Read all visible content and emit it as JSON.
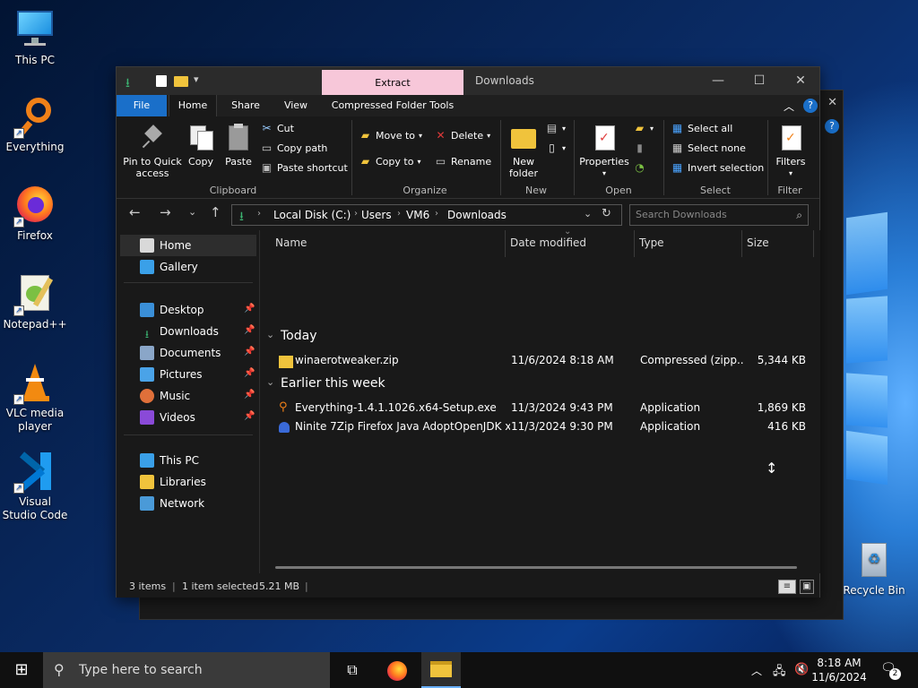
{
  "desktop": {
    "icons": [
      {
        "label": "This PC",
        "icon": "monitor-icon"
      },
      {
        "label": "Everything",
        "icon": "everything-magnifier-icon"
      },
      {
        "label": "Firefox",
        "icon": "firefox-icon"
      },
      {
        "label": "Notepad++",
        "icon": "notepad-plus-plus-icon"
      },
      {
        "label": "VLC media player",
        "icon": "vlc-cone-icon"
      },
      {
        "label": "Visual Studio Code",
        "icon": "vscode-icon"
      },
      {
        "label": "Recycle Bin",
        "icon": "recycle-bin-icon"
      }
    ]
  },
  "window": {
    "context_tab": "Extract",
    "title": "Downloads",
    "ribbon_tabs": [
      "File",
      "Home",
      "Share",
      "View",
      "Compressed Folder Tools"
    ],
    "ribbon": {
      "clipboard": {
        "pin_label": "Pin to Quick access",
        "copy": "Copy",
        "paste": "Paste",
        "cut": "Cut",
        "copy_path": "Copy path",
        "paste_shortcut": "Paste shortcut",
        "group": "Clipboard"
      },
      "organize": {
        "move_to": "Move to",
        "copy_to": "Copy to",
        "delete": "Delete",
        "rename": "Rename",
        "group": "Organize"
      },
      "new": {
        "new_folder": "New folder",
        "group": "New"
      },
      "open": {
        "properties": "Properties",
        "group": "Open"
      },
      "select": {
        "select_all": "Select all",
        "select_none": "Select none",
        "invert": "Invert selection",
        "group": "Select"
      },
      "filter": {
        "filters": "Filters",
        "group": "Filter"
      }
    },
    "address": {
      "crumbs": [
        "Local Disk (C:)",
        "Users",
        "VM6",
        "Downloads"
      ],
      "search_placeholder": "Search Downloads"
    },
    "nav": {
      "home": "Home",
      "gallery": "Gallery",
      "quick": [
        "Desktop",
        "Downloads",
        "Documents",
        "Pictures",
        "Music",
        "Videos"
      ],
      "this_pc": "This PC",
      "libraries": "Libraries",
      "network": "Network"
    },
    "columns": {
      "name": "Name",
      "date": "Date modified",
      "type": "Type",
      "size": "Size"
    },
    "groups": [
      {
        "title": "Today",
        "files": [
          {
            "name": "winaerotweaker.zip",
            "date": "11/6/2024 8:18 AM",
            "type": "Compressed (zipp...",
            "size": "5,344 KB"
          }
        ]
      },
      {
        "title": "Earlier this week",
        "files": [
          {
            "name": "Everything-1.4.1.1026.x64-Setup.exe",
            "date": "11/3/2024 9:43 PM",
            "type": "Application",
            "size": "1,869 KB"
          },
          {
            "name": "Ninite 7Zip Firefox Java AdoptOpenJDK x...",
            "date": "11/3/2024 9:30 PM",
            "type": "Application",
            "size": "416 KB"
          }
        ]
      }
    ],
    "status": {
      "count": "3 items",
      "selected": "1 item selected",
      "size": "5.21 MB"
    }
  },
  "taskbar": {
    "search_placeholder": "Type here to search",
    "time": "8:18 AM",
    "date": "11/6/2024",
    "notifications": "2"
  },
  "colors": {
    "accent": "#1a6fc9",
    "context_tab": "#f7c7d9",
    "window_bg": "#191919"
  }
}
